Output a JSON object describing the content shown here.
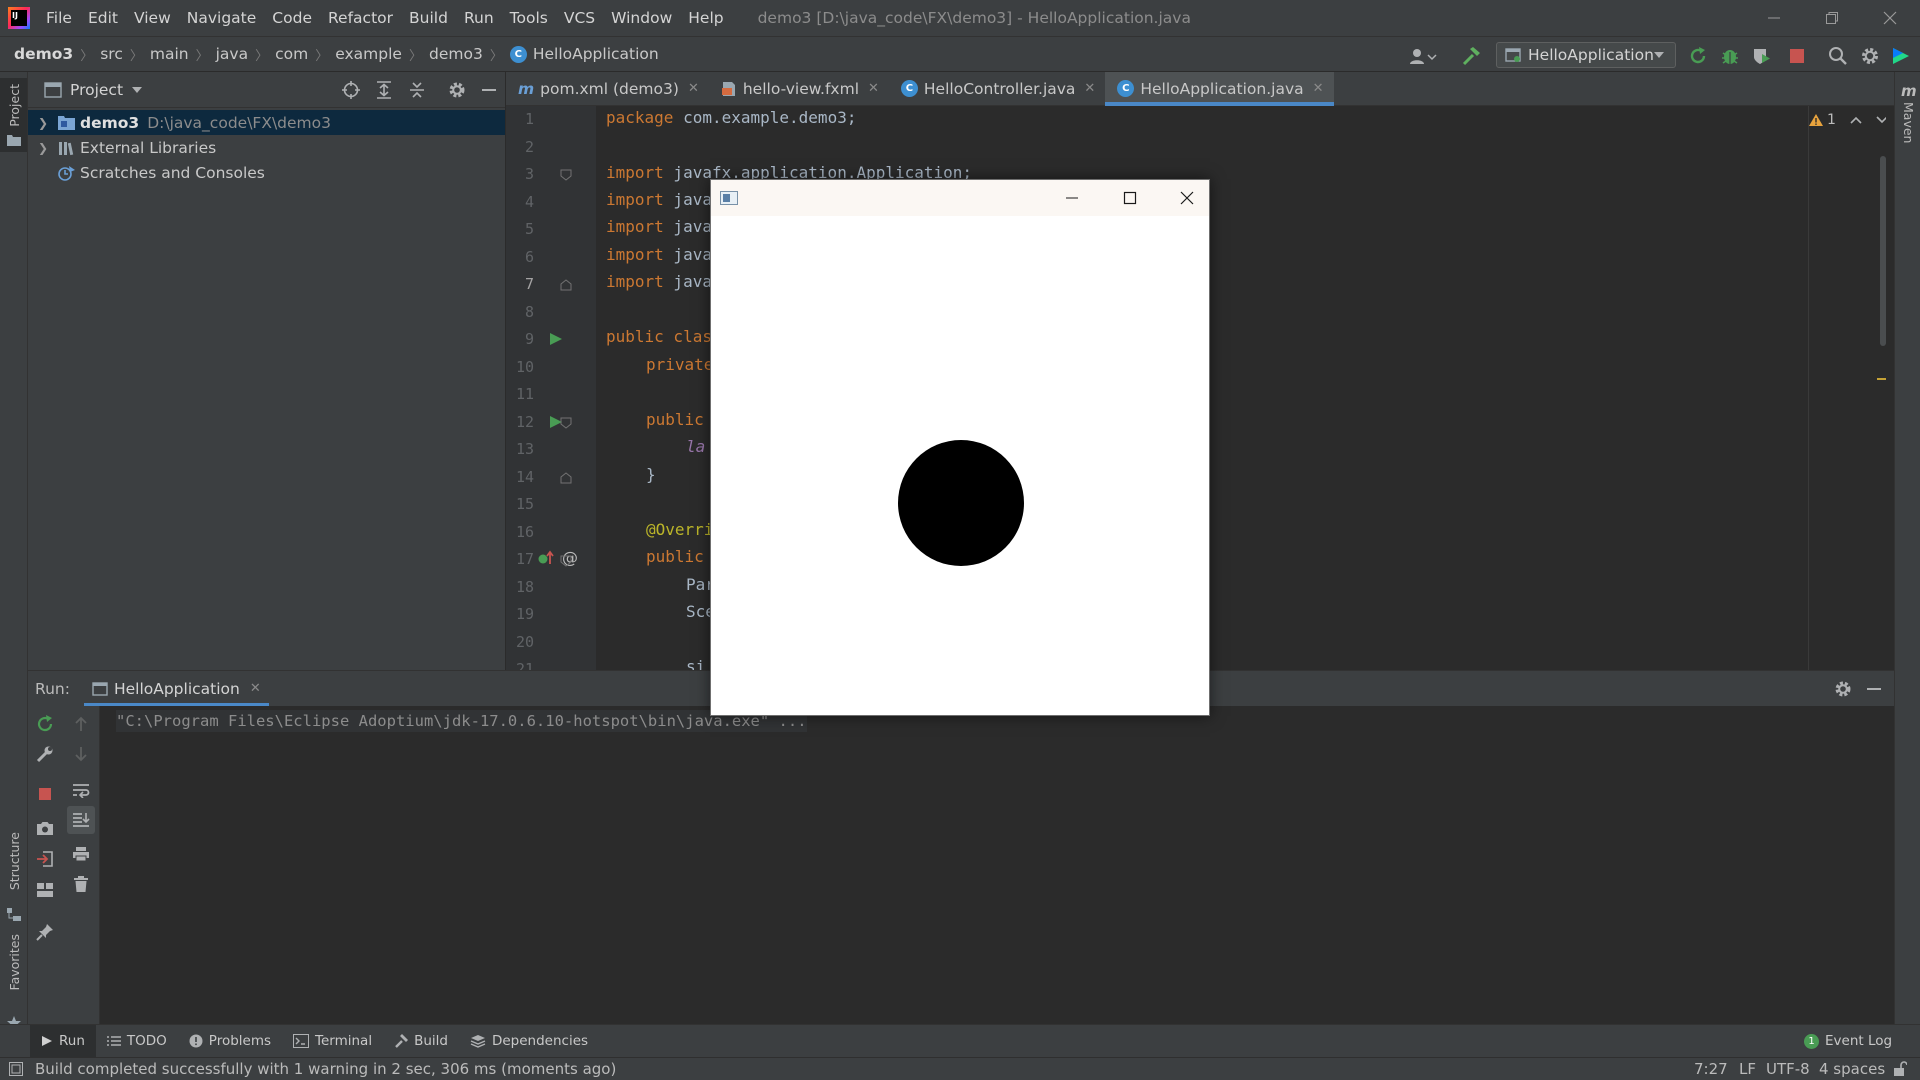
{
  "menu": [
    "File",
    "Edit",
    "View",
    "Navigate",
    "Code",
    "Refactor",
    "Build",
    "Run",
    "Tools",
    "VCS",
    "Window",
    "Help"
  ],
  "window_title": "demo3 [D:\\java_code\\FX\\demo3] - HelloApplication.java",
  "breadcrumb": [
    "demo3",
    "src",
    "main",
    "java",
    "com",
    "example",
    "demo3",
    "HelloApplication"
  ],
  "run_config": "HelloApplication",
  "project": {
    "title": "Project",
    "tree": [
      {
        "name": "demo3",
        "path": "D:\\java_code\\FX\\demo3"
      },
      {
        "name": "External Libraries"
      },
      {
        "name": "Scratches and Consoles"
      }
    ]
  },
  "left_stripe": {
    "project": "Project",
    "structure": "Structure",
    "favorites": "Favorites"
  },
  "right_stripe": {
    "maven": "Maven"
  },
  "tabs": [
    "pom.xml (demo3)",
    "hello-view.fxml",
    "HelloController.java",
    "HelloApplication.java"
  ],
  "editor": {
    "inspection_count": "1",
    "line_numbers": [
      "1",
      "2",
      "3",
      "4",
      "5",
      "6",
      "7",
      "8",
      "9",
      "10",
      "11",
      "12",
      "13",
      "14",
      "15",
      "16",
      "17",
      "18",
      "19",
      "20",
      "21"
    ],
    "lines": {
      "l1_kw": "package",
      "l1_rest": " com.example.demo3;",
      "l3_kw": "import",
      "l3_rest": " javafx.application.Application;",
      "l4_kw": "import",
      "l4_rest": " java",
      "l5_kw": "import",
      "l5_rest": " java",
      "l6_kw": "import",
      "l6_rest": " java",
      "l7_kw": "import",
      "l7_rest": " java",
      "l9_kw": "public class",
      "l10_kw": "private",
      "l12_kw": "public",
      "l13_it": "la",
      "l14": "}",
      "l16_ann": "@Overri",
      "l17_kw": "public",
      "l18": "Par",
      "l19": "Sce",
      "l21": "si"
    }
  },
  "run_panel": {
    "label": "Run:",
    "tab": "HelloApplication",
    "console": "\"C:\\Program Files\\Eclipse Adoptium\\jdk-17.0.6.10-hotspot\\bin\\java.exe\" ..."
  },
  "bottom_tools": [
    "Run",
    "TODO",
    "Problems",
    "Terminal",
    "Build",
    "Dependencies"
  ],
  "event_log": {
    "count": "1",
    "label": "Event Log"
  },
  "status": {
    "message": "Build completed successfully with 1 warning in 2 sec, 306 ms (moments ago)",
    "position": "7:27",
    "line_sep": "LF",
    "encoding": "UTF-8",
    "indent": "4 spaces"
  },
  "colors": {
    "accent": "#4a88c7",
    "run_green": "#499c54",
    "stop_red": "#c75450",
    "keyword": "#cc7832"
  }
}
